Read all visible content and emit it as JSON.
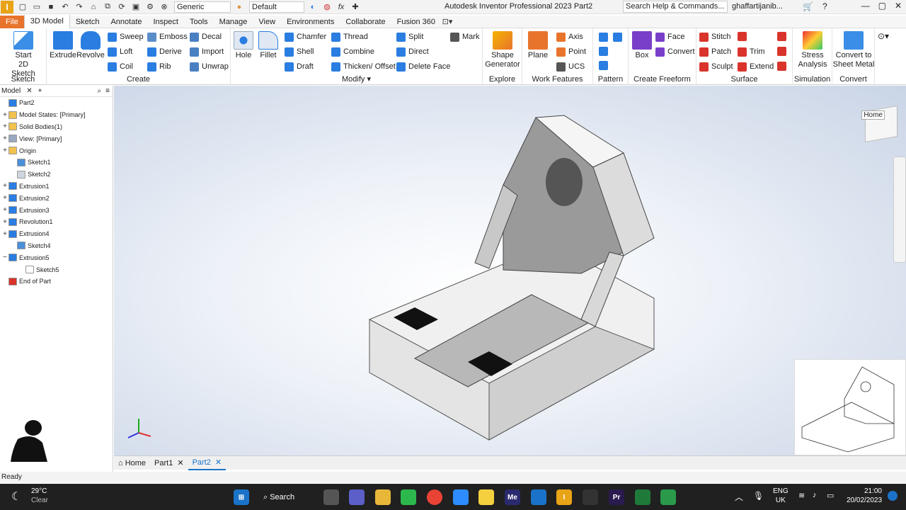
{
  "titlebar": {
    "title": "Autodesk Inventor Professional 2023   Part2",
    "appearance_select": "Generic",
    "material_select": "Default",
    "fx_label": "fx",
    "search_placeholder": "Search Help & Commands...",
    "user": "ghaffartijanib..."
  },
  "tabs": [
    {
      "label": "File"
    },
    {
      "label": "3D Model"
    },
    {
      "label": "Sketch"
    },
    {
      "label": "Annotate"
    },
    {
      "label": "Inspect"
    },
    {
      "label": "Tools"
    },
    {
      "label": "Manage"
    },
    {
      "label": "View"
    },
    {
      "label": "Environments"
    },
    {
      "label": "Collaborate"
    },
    {
      "label": "Fusion 360"
    }
  ],
  "ribbon": {
    "sketch": {
      "label": "Sketch",
      "start": "Start",
      "start2": "2D Sketch"
    },
    "create": {
      "label": "Create",
      "extrude": "Extrude",
      "revolve": "Revolve",
      "sweep": "Sweep",
      "loft": "Loft",
      "coil": "Coil",
      "emboss": "Emboss",
      "derive": "Derive",
      "rib": "Rib",
      "decal": "Decal",
      "import": "Import",
      "unwrap": "Unwrap"
    },
    "modify": {
      "label": "Modify ▾",
      "hole": "Hole",
      "fillet": "Fillet",
      "chamfer": "Chamfer",
      "shell": "Shell",
      "draft": "Draft",
      "thread": "Thread",
      "combine": "Combine",
      "thicken": "Thicken/ Offset",
      "split": "Split",
      "direct": "Direct",
      "delete_face": "Delete Face"
    },
    "mark": "Mark",
    "explore": {
      "label": "Explore",
      "shape": "Shape",
      "generator": "Generator"
    },
    "work": {
      "label": "Work Features",
      "plane": "Plane",
      "axis": "Axis",
      "point": "Point",
      "ucs": "UCS"
    },
    "pattern": {
      "label": "Pattern"
    },
    "freeform": {
      "label": "Create Freeform",
      "box": "Box",
      "face": "Face",
      "convert": "Convert"
    },
    "surface": {
      "label": "Surface",
      "stitch": "Stitch",
      "patch": "Patch",
      "sculpt": "Sculpt",
      "trim": "Trim",
      "extend": "Extend"
    },
    "simulation": {
      "label": "Simulation",
      "stress": "Stress",
      "analysis": "Analysis"
    },
    "convert": {
      "label": "Convert",
      "line1": "Convert to",
      "line2": "Sheet Metal"
    }
  },
  "browser": {
    "tab": "Model",
    "tree": [
      {
        "label": "Part2",
        "expander": "",
        "indent": 0,
        "color": "#2a7de1"
      },
      {
        "label": "Model States: [Primary]",
        "expander": "+",
        "indent": 0,
        "color": "#f2c14e"
      },
      {
        "label": "Solid Bodies(1)",
        "expander": "+",
        "indent": 0,
        "color": "#f2c14e"
      },
      {
        "label": "View: [Primary]",
        "expander": "+",
        "indent": 0,
        "color": "#9aa8c0"
      },
      {
        "label": "Origin",
        "expander": "+",
        "indent": 0,
        "color": "#f2c14e"
      },
      {
        "label": "Sketch1",
        "expander": "",
        "indent": 1,
        "color": "#4a90d9"
      },
      {
        "label": "Sketch2",
        "expander": "",
        "indent": 1,
        "color": "#cfd6df"
      },
      {
        "label": "Extrusion1",
        "expander": "+",
        "indent": 0,
        "color": "#2a7de1"
      },
      {
        "label": "Extrusion2",
        "expander": "+",
        "indent": 0,
        "color": "#2a7de1"
      },
      {
        "label": "Extrusion3",
        "expander": "+",
        "indent": 0,
        "color": "#2a7de1"
      },
      {
        "label": "Revolution1",
        "expander": "+",
        "indent": 0,
        "color": "#2a7de1"
      },
      {
        "label": "Extrusion4",
        "expander": "+",
        "indent": 0,
        "color": "#2a7de1"
      },
      {
        "label": "Sketch4",
        "expander": "",
        "indent": 1,
        "color": "#4a90d9"
      },
      {
        "label": "Extrusion5",
        "expander": "−",
        "indent": 0,
        "color": "#2a7de1"
      },
      {
        "label": "Sketch5",
        "expander": "",
        "indent": 2,
        "color": "#ffffff"
      },
      {
        "label": "End of Part",
        "expander": "",
        "indent": 0,
        "color": "#d9342b"
      }
    ]
  },
  "viewcube": {
    "home": "Home"
  },
  "doc_tabs": {
    "home": "Home",
    "part1": "Part1",
    "part2": "Part2"
  },
  "status": "Ready",
  "taskbar": {
    "temp": "29°C",
    "weather": "Clear",
    "search": "Search",
    "lang1": "ENG",
    "lang2": "UK",
    "time": "21:00",
    "date": "20/02/2023"
  },
  "colors": {
    "accent": "#1a73c8",
    "file_tab": "#e8742c",
    "taskbar": "#202020"
  }
}
